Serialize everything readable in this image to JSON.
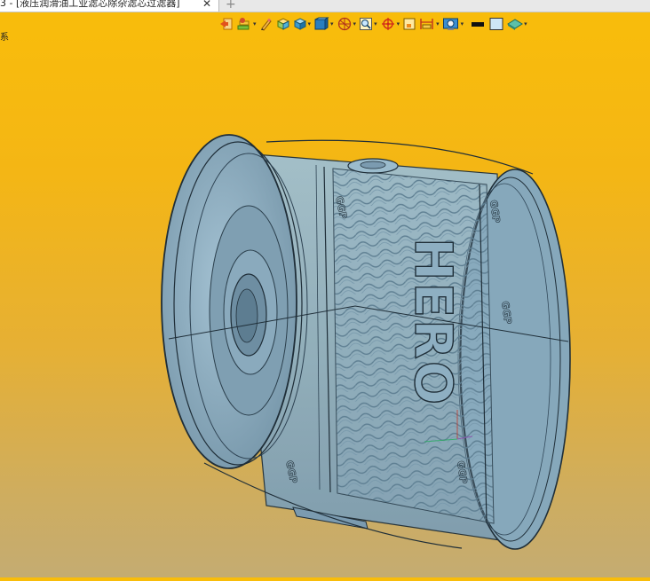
{
  "window": {
    "tab_title": "3 - [液压润滑油工业滤芯除杂滤芯过滤器]",
    "tab_close": "✕",
    "new_tab": "+",
    "side_fragment": "系"
  },
  "toolbar": {
    "buttons": [
      {
        "name": "exit-icon",
        "dropdown": false
      },
      {
        "name": "layers-icon",
        "dropdown": true
      },
      {
        "name": "pencil-icon",
        "dropdown": false
      },
      {
        "name": "shaded-box-icon",
        "dropdown": false
      },
      {
        "name": "solid-box-icon",
        "dropdown": true
      },
      {
        "name": "view-cube-icon",
        "dropdown": true
      },
      {
        "name": "section-view-icon",
        "dropdown": true
      },
      {
        "name": "zoom-fit-icon",
        "dropdown": true
      },
      {
        "name": "crosshair-icon",
        "dropdown": true
      },
      {
        "name": "frame-icon",
        "dropdown": false
      },
      {
        "name": "dimension-icon",
        "dropdown": true
      },
      {
        "name": "render-mode-icon",
        "dropdown": true
      },
      {
        "name": "line-color-icon",
        "dropdown": false
      },
      {
        "name": "fill-color-icon",
        "dropdown": false
      },
      {
        "name": "display-style-icon",
        "dropdown": true
      }
    ],
    "dropdown_glyph": "▾"
  },
  "model": {
    "emboss_text": "HERO",
    "band_text": "GGP",
    "colors": {
      "body": "#8fb1c4",
      "body_dark": "#6f93a8",
      "outline": "#1f2e38",
      "pattern": "#4e6f82"
    }
  }
}
